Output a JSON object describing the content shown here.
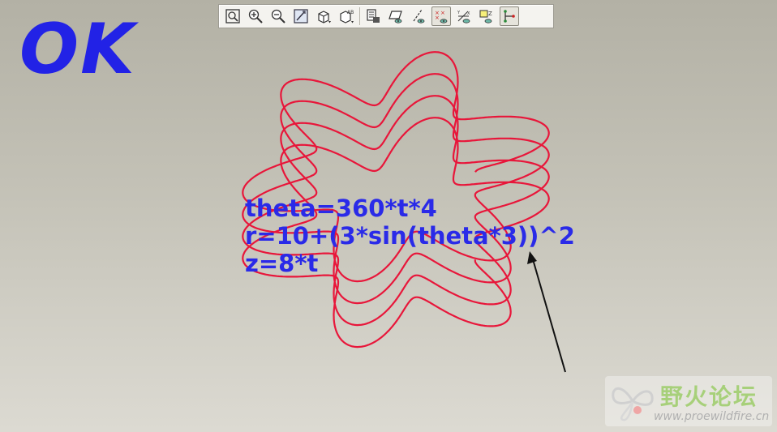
{
  "status_label": "OK",
  "equations": {
    "line1": "theta=360*t*4",
    "line2": "r=10+(3*sin(theta*3))^2",
    "line3": "z=8*t"
  },
  "watermark": {
    "name": "野火论坛",
    "url": "www.proewildfire.cn"
  },
  "toolbar": {
    "buttons": [
      {
        "icon": "zoom-fit-icon"
      },
      {
        "icon": "zoom-in-icon"
      },
      {
        "icon": "zoom-out-icon"
      },
      {
        "icon": "repaint-icon"
      },
      {
        "icon": "display-style-icon"
      },
      {
        "icon": "saved-views-icon"
      },
      {
        "icon": "layers-icon"
      },
      {
        "icon": "datum-planes-icon"
      },
      {
        "icon": "datum-axes-icon"
      },
      {
        "icon": "datum-points-icon"
      },
      {
        "icon": "coordinate-systems-icon"
      },
      {
        "icon": "annotations-icon"
      },
      {
        "icon": "spin-center-icon"
      }
    ]
  },
  "colors": {
    "curve": "#e8163a",
    "text": "#2a2ae8",
    "background_top": "#b3b1a5",
    "background_bottom": "#dcdad2"
  },
  "curve_data": {
    "equations": "theta=360*t*4, r=10+(3*sin(theta*3))^2, z=8*t",
    "turns": 4,
    "lobes": 6
  }
}
